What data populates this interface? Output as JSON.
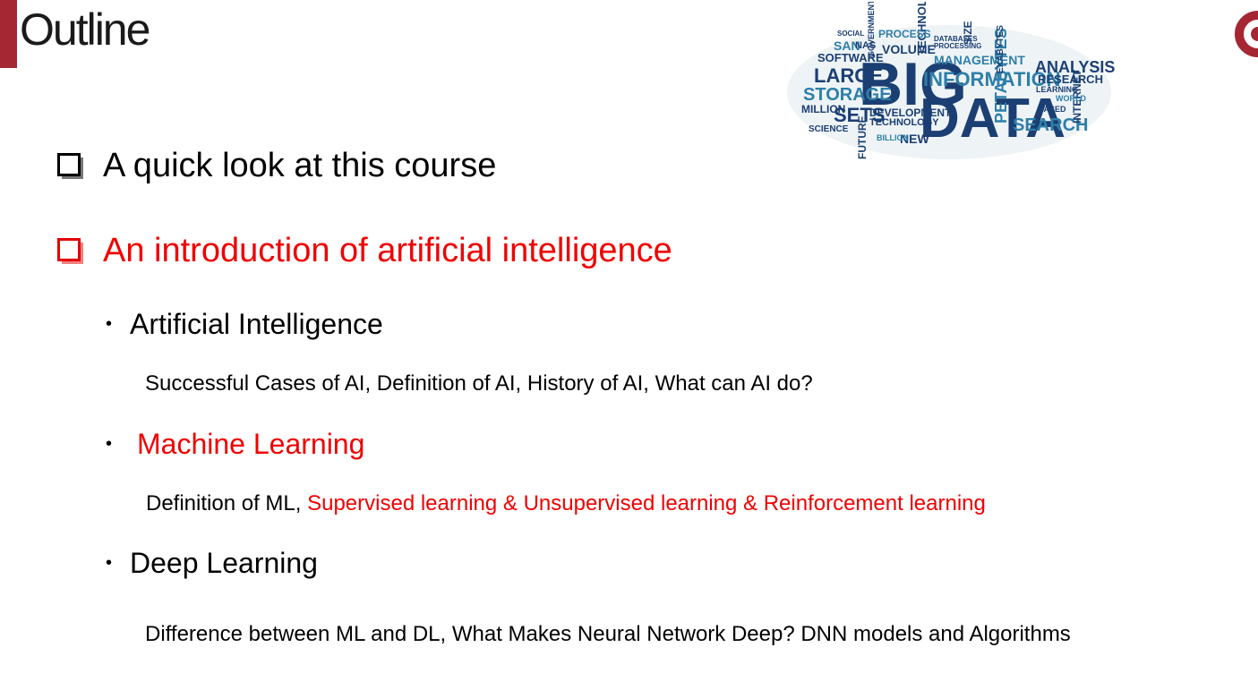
{
  "header": {
    "title": "Outline",
    "accent_color": "#a52734"
  },
  "word_cloud": {
    "words": [
      "BIG",
      "DATA",
      "INFORMATION",
      "LARGE",
      "STORAGE",
      "SETS",
      "ANALYSIS",
      "SEARCH",
      "PETABYTES",
      "MANAGEMENT",
      "TECHNOLOGIES",
      "SOFTWARE",
      "VOLUME",
      "PROCESS",
      "RESEARCH",
      "INTERNET",
      "DEVELOPMENT",
      "TECHNOLOGY",
      "MILLION",
      "SCIENCE",
      "FUTURE",
      "NEW",
      "BILLION",
      "EXABYTES",
      "SIZE",
      "SAN",
      "NAS",
      "PROCESSING",
      "DATABASES",
      "LEARNING",
      "WORLD",
      "BASED",
      "GOVERNMENT",
      "SOCIAL"
    ]
  },
  "outline": {
    "sections": [
      {
        "label": "A quick look at this course",
        "highlight": false
      },
      {
        "label": "An introduction of artificial intelligence",
        "highlight": true
      }
    ],
    "topics": [
      {
        "label": "Artificial Intelligence",
        "detail": "Successful Cases of AI, Definition of AI, History of AI, What can AI do?"
      },
      {
        "label": "Machine Learning",
        "detail_plain": "Definition of ML, ",
        "detail_highlight": "Supervised learning & Unsupervised learning & Reinforcement learning"
      },
      {
        "label": "Deep Learning",
        "detail": "Difference between ML and DL, What Makes Neural Network Deep? DNN models and Algorithms"
      }
    ],
    "bullet_glyph": "•",
    "highlight_color": "#f00000"
  }
}
